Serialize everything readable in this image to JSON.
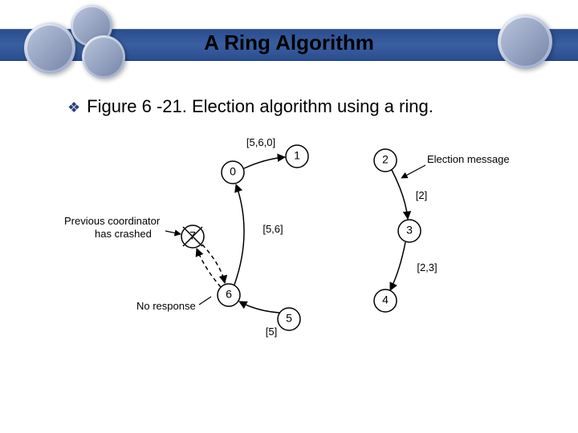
{
  "header": {
    "title": "A Ring Algorithm"
  },
  "bullet": {
    "text": "Figure 6 -21. Election algorithm using a ring."
  },
  "diagram": {
    "nodes": {
      "n0": "0",
      "n1": "1",
      "n2": "2",
      "n3": "3",
      "n4": "4",
      "n5": "5",
      "n6": "6",
      "n7": "7"
    },
    "messages": {
      "m560": "[5,6,0]",
      "m56": "[5,6]",
      "m5": "[5]",
      "m2": "[2]",
      "m23": "[2,3]"
    },
    "annotations": {
      "crashed1": "Previous coordinator",
      "crashed2": "has crashed",
      "noresp": "No response",
      "elect": "Election message"
    }
  }
}
